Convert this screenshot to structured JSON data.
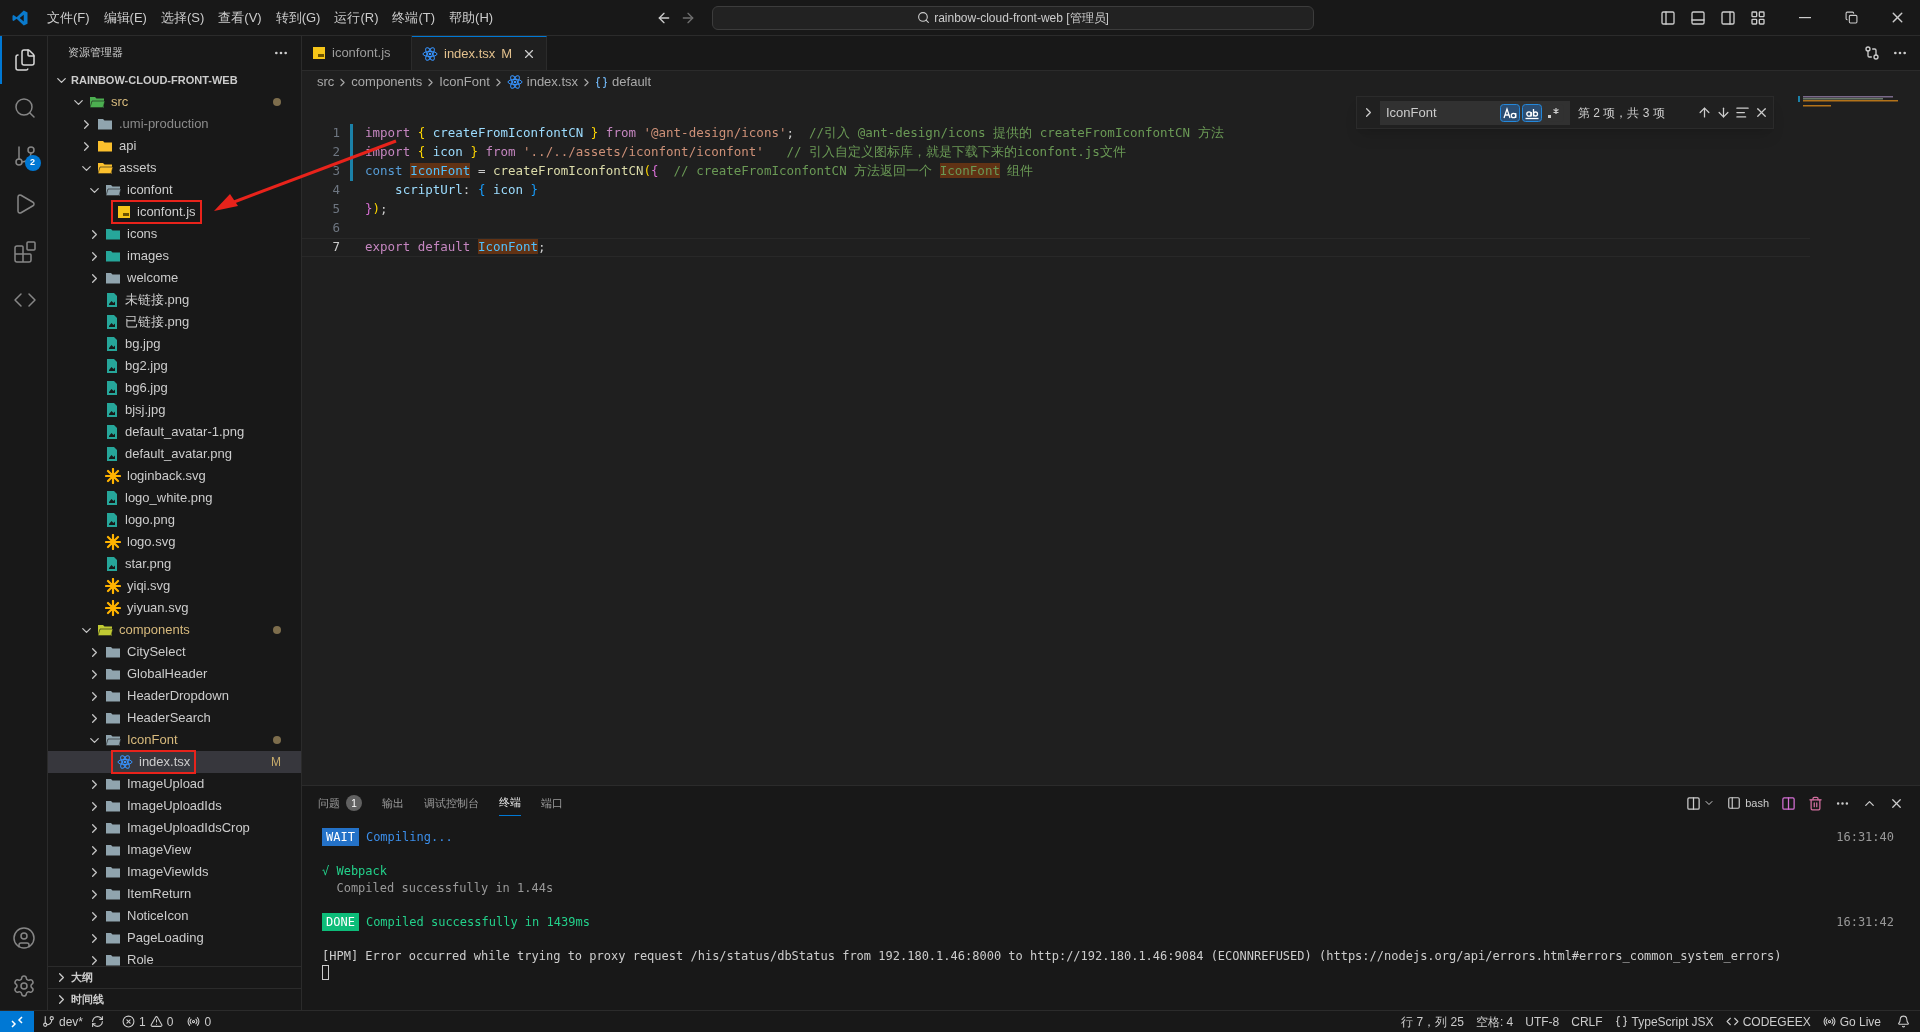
{
  "menu": [
    "文件(F)",
    "编辑(E)",
    "选择(S)",
    "查看(V)",
    "转到(G)",
    "运行(R)",
    "终端(T)",
    "帮助(H)"
  ],
  "command_center": "rainbow-cloud-front-web [管理员]",
  "activity_bar": [
    {
      "selected": true
    },
    {
      "selected": false
    },
    {
      "selected": false,
      "badge": "2"
    },
    {
      "selected": false
    },
    {
      "selected": false
    },
    {
      "selected": false
    }
  ],
  "explorer": {
    "title": "资源管理器",
    "root": "RAINBOW-CLOUD-FRONT-WEB",
    "tree": [
      {
        "name": "src",
        "kind": "folder-src",
        "expanded": true,
        "dot": true,
        "children": [
          {
            "name": ".umi-production",
            "kind": "folder",
            "expanded": false,
            "dimmed": true
          },
          {
            "name": "api",
            "kind": "folder-api",
            "expanded": false
          },
          {
            "name": "assets",
            "kind": "folder-assets",
            "expanded": true,
            "children": [
              {
                "name": "iconfont",
                "kind": "folder",
                "expanded": true,
                "children": [
                  {
                    "name": "iconfont.js",
                    "kind": "js",
                    "highlighted": true
                  }
                ]
              },
              {
                "name": "icons",
                "kind": "folder-media",
                "expanded": false
              },
              {
                "name": "images",
                "kind": "folder-media",
                "expanded": false
              },
              {
                "name": "welcome",
                "kind": "folder",
                "expanded": false
              },
              {
                "name": "未链接.png",
                "kind": "image"
              },
              {
                "name": "已链接.png",
                "kind": "image"
              },
              {
                "name": "bg.jpg",
                "kind": "image"
              },
              {
                "name": "bg2.jpg",
                "kind": "image"
              },
              {
                "name": "bg6.jpg",
                "kind": "image"
              },
              {
                "name": "bjsj.jpg",
                "kind": "image"
              },
              {
                "name": "default_avatar-1.png",
                "kind": "image"
              },
              {
                "name": "default_avatar.png",
                "kind": "image"
              },
              {
                "name": "loginback.svg",
                "kind": "svg"
              },
              {
                "name": "logo_white.png",
                "kind": "image"
              },
              {
                "name": "logo.png",
                "kind": "image"
              },
              {
                "name": "logo.svg",
                "kind": "svg"
              },
              {
                "name": "star.png",
                "kind": "image"
              },
              {
                "name": "yiqi.svg",
                "kind": "svg"
              },
              {
                "name": "yiyuan.svg",
                "kind": "svg"
              }
            ]
          },
          {
            "name": "components",
            "kind": "folder-components",
            "expanded": true,
            "dot": true,
            "children": [
              {
                "name": "CitySelect",
                "kind": "folder",
                "expanded": false
              },
              {
                "name": "GlobalHeader",
                "kind": "folder",
                "expanded": false
              },
              {
                "name": "HeaderDropdown",
                "kind": "folder",
                "expanded": false
              },
              {
                "name": "HeaderSearch",
                "kind": "folder",
                "expanded": false
              },
              {
                "name": "IconFont",
                "kind": "folder",
                "expanded": true,
                "dot": true,
                "children": [
                  {
                    "name": "index.tsx",
                    "kind": "react",
                    "selected": true,
                    "highlighted": true,
                    "badge": "M"
                  }
                ]
              },
              {
                "name": "ImageUpload",
                "kind": "folder",
                "expanded": false
              },
              {
                "name": "ImageUploadIds",
                "kind": "folder",
                "expanded": false
              },
              {
                "name": "ImageUploadIdsCrop",
                "kind": "folder",
                "expanded": false
              },
              {
                "name": "ImageView",
                "kind": "folder",
                "expanded": false
              },
              {
                "name": "ImageViewIds",
                "kind": "folder",
                "expanded": false
              },
              {
                "name": "ItemReturn",
                "kind": "folder",
                "expanded": false
              },
              {
                "name": "NoticeIcon",
                "kind": "folder",
                "expanded": false
              },
              {
                "name": "PageLoading",
                "kind": "folder",
                "expanded": false
              },
              {
                "name": "Role",
                "kind": "folder",
                "expanded": false
              }
            ]
          }
        ]
      }
    ]
  },
  "sections": [
    {
      "label": "大纲",
      "expanded": false
    },
    {
      "label": "时间线",
      "expanded": false
    }
  ],
  "tabs": [
    {
      "label": "iconfont.js",
      "kind": "js",
      "selected": false
    },
    {
      "label": "index.tsx",
      "kind": "react",
      "selected": true,
      "badge": "M"
    }
  ],
  "breadcrumb": [
    {
      "label": "src",
      "kind": "folder"
    },
    {
      "label": "components",
      "kind": "folder"
    },
    {
      "label": "IconFont",
      "kind": "folder"
    },
    {
      "label": "index.tsx",
      "kind": "react"
    },
    {
      "label": "default",
      "kind": "symbol"
    }
  ],
  "find": {
    "value": "IconFont",
    "match_case": true,
    "whole_word": true,
    "regex": false,
    "count": "第 2 项，共 3 项"
  },
  "code": [
    {
      "number": "1",
      "modified": true,
      "current": false,
      "tokens": [
        {
          "kind": "keyword",
          "text": "import "
        },
        {
          "kind": "brace",
          "text": "{"
        },
        {
          "kind": "variable",
          "text": " createFromIconfontCN "
        },
        {
          "kind": "brace",
          "text": "}"
        },
        {
          "kind": "keyword",
          "text": " from "
        },
        {
          "kind": "string",
          "text": "'@ant-design/icons'"
        },
        {
          "kind": "plain",
          "text": ";  "
        },
        {
          "kind": "comment",
          "text": "//引入 @ant-design/icons 提供的 createFromIconfontCN 方法"
        }
      ]
    },
    {
      "number": "2",
      "modified": true,
      "current": false,
      "tokens": [
        {
          "kind": "keyword",
          "text": "import "
        },
        {
          "kind": "brace",
          "text": "{"
        },
        {
          "kind": "variable",
          "text": " icon "
        },
        {
          "kind": "brace",
          "text": "}"
        },
        {
          "kind": "keyword",
          "text": " from "
        },
        {
          "kind": "string",
          "text": "'../../assets/iconfont/iconfont'"
        },
        {
          "kind": "comment",
          "text": "   // 引入自定义图标库，就是下载下来的iconfont.js文件"
        }
      ]
    },
    {
      "number": "3",
      "modified": true,
      "current": false,
      "tokens": [
        {
          "kind": "declaration",
          "text": "const "
        },
        {
          "kind": "constant",
          "text": "IconFont",
          "match": true
        },
        {
          "kind": "plain",
          "text": " = "
        },
        {
          "kind": "function",
          "text": "createFromIconfontCN"
        },
        {
          "kind": "brace",
          "text": "("
        },
        {
          "kind": "brace2",
          "text": "{"
        },
        {
          "kind": "comment",
          "text": "  // createFromIconfontCN 方法返回一个 "
        },
        {
          "kind": "comment",
          "text": "IconFont",
          "match": true
        },
        {
          "kind": "comment",
          "text": " 组件"
        }
      ]
    },
    {
      "number": "4",
      "modified": false,
      "current": false,
      "tokens": [
        {
          "kind": "variable",
          "text": "    scriptUrl"
        },
        {
          "kind": "plain",
          "text": ": "
        },
        {
          "kind": "brace3",
          "text": "{"
        },
        {
          "kind": "variable",
          "text": " icon "
        },
        {
          "kind": "brace3",
          "text": "}"
        }
      ]
    },
    {
      "number": "5",
      "modified": false,
      "current": false,
      "tokens": [
        {
          "kind": "brace2",
          "text": "}"
        },
        {
          "kind": "brace",
          "text": ")"
        },
        {
          "kind": "plain",
          "text": ";"
        }
      ]
    },
    {
      "number": "6",
      "modified": false,
      "current": false
    },
    {
      "number": "7",
      "modified": false,
      "current": true,
      "tokens": [
        {
          "kind": "keyword",
          "text": "export default "
        },
        {
          "kind": "constant",
          "text": "IconFont",
          "match": true
        },
        {
          "kind": "plain",
          "text": ";"
        }
      ]
    }
  ],
  "panel": {
    "tabs": [
      {
        "label": "问题",
        "selected": false,
        "badge": "1"
      },
      {
        "label": "输出",
        "selected": false
      },
      {
        "label": "调试控制台",
        "selected": false
      },
      {
        "label": "终端",
        "selected": true
      },
      {
        "label": "端口",
        "selected": false
      }
    ],
    "shell": "bash",
    "terminal": [
      {
        "kind": "info",
        "tag": "WAIT",
        "text": "Compiling...",
        "time": "16:31:40"
      },
      {
        "kind": "blank"
      },
      {
        "kind": "success",
        "text": "√ Webpack"
      },
      {
        "kind": "muted",
        "text": "  Compiled successfully in 1.44s"
      },
      {
        "kind": "blank"
      },
      {
        "kind": "success",
        "tag": "DONE",
        "text": "Compiled successfully in 1439ms",
        "time": "16:31:42"
      },
      {
        "kind": "blank"
      },
      {
        "kind": "plain",
        "text": "[HPM] Error occurred while trying to proxy request /his/status/dbStatus from 192.180.1.46:8000 to http://192.180.1.46:9084 (ECONNREFUSED) (https://nodejs.org/api/errors.html#errors_common_system_errors)"
      },
      {
        "kind": "cursor"
      }
    ]
  },
  "status_bar": {
    "branch": "dev*",
    "errors": "1",
    "warnings": "0",
    "ports": "0",
    "right": [
      {
        "kind": "text",
        "label": "行 7，列 25"
      },
      {
        "kind": "text",
        "label": "空格: 4"
      },
      {
        "kind": "text",
        "label": "UTF-8"
      },
      {
        "kind": "text",
        "label": "CRLF"
      },
      {
        "kind": "braces",
        "label": "TypeScript JSX"
      },
      {
        "kind": "code",
        "label": "CODEGEEX"
      },
      {
        "kind": "broadcast",
        "label": "Go Live"
      }
    ]
  }
}
